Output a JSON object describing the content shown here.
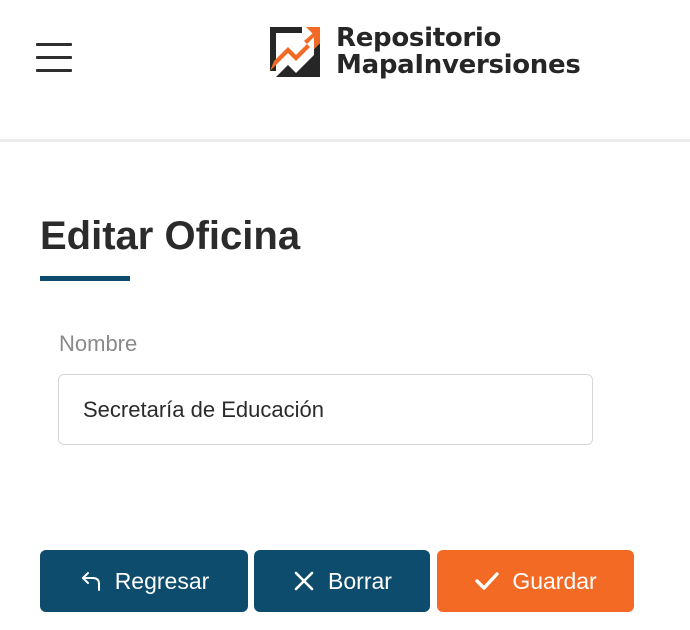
{
  "header": {
    "logo_line1": "Repositorio",
    "logo_line2": "MapaInversiones",
    "menu_icon": "hamburger-menu-icon",
    "logo_icon": "growth-chart-logo-icon"
  },
  "page": {
    "title": "Editar Oficina"
  },
  "form": {
    "name_label": "Nombre",
    "name_value": "Secretaría de Educación"
  },
  "actions": {
    "back_label": "Regresar",
    "back_icon": "return-arrow-icon",
    "clear_label": "Borrar",
    "clear_icon": "close-x-icon",
    "save_label": "Guardar",
    "save_icon": "checkmark-icon"
  },
  "colors": {
    "primary": "#0d4c6d",
    "accent": "#f26a24",
    "text": "#2b2b2b",
    "muted": "#8a8a8a"
  }
}
